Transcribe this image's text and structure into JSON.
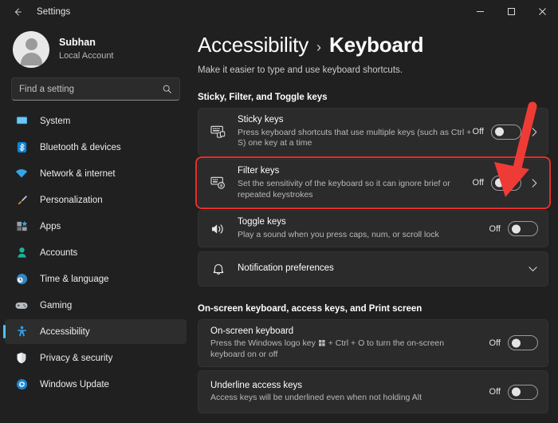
{
  "titlebar": {
    "back_label": "back-arrow",
    "title": "Settings",
    "minimize_label": "Minimize",
    "maximize_label": "Maximize",
    "close_label": "Close"
  },
  "sidebar": {
    "account": {
      "name": "Subhan",
      "type": "Local Account"
    },
    "search": {
      "placeholder": "Find a setting",
      "value": "",
      "icon": "search-icon"
    },
    "items": [
      {
        "label": "System",
        "icon": "display-icon",
        "selected": false
      },
      {
        "label": "Bluetooth & devices",
        "icon": "bluetooth-icon",
        "selected": false
      },
      {
        "label": "Network & internet",
        "icon": "wifi-icon",
        "selected": false
      },
      {
        "label": "Personalization",
        "icon": "paintbrush-icon",
        "selected": false
      },
      {
        "label": "Apps",
        "icon": "apps-icon",
        "selected": false
      },
      {
        "label": "Accounts",
        "icon": "account-icon",
        "selected": false
      },
      {
        "label": "Time & language",
        "icon": "clock-icon",
        "selected": false
      },
      {
        "label": "Gaming",
        "icon": "gamepad-icon",
        "selected": false
      },
      {
        "label": "Accessibility",
        "icon": "accessibility-icon",
        "selected": true
      },
      {
        "label": "Privacy & security",
        "icon": "shield-icon",
        "selected": false
      },
      {
        "label": "Windows Update",
        "icon": "update-icon",
        "selected": false
      }
    ]
  },
  "main": {
    "breadcrumb": {
      "parent": "Accessibility",
      "separator": "›",
      "current": "Keyboard"
    },
    "subtitle": "Make it easier to type and use keyboard shortcuts.",
    "sections": [
      {
        "heading": "Sticky, Filter, and Toggle keys",
        "rows": [
          {
            "name": "sticky-keys",
            "icon": "keyboard-sticky-icon",
            "title": "Sticky keys",
            "desc": "Press keyboard shortcuts that use multiple keys (such as Ctrl + S) one key at a time",
            "toggle_label": "Off",
            "toggle_state": "off",
            "chevron": "right",
            "highlighted": false
          },
          {
            "name": "filter-keys",
            "icon": "keyboard-filter-icon",
            "title": "Filter keys",
            "desc": "Set the sensitivity of the keyboard so it can ignore brief or repeated keystrokes",
            "toggle_label": "Off",
            "toggle_state": "off",
            "chevron": "right",
            "highlighted": true
          },
          {
            "name": "toggle-keys",
            "icon": "speaker-icon",
            "title": "Toggle keys",
            "desc": "Play a sound when you press caps, num, or scroll lock",
            "toggle_label": "Off",
            "toggle_state": "off",
            "chevron": "none",
            "highlighted": false
          },
          {
            "name": "notification-preferences",
            "icon": "bell-icon",
            "title": "Notification preferences",
            "desc": "",
            "toggle_label": "",
            "toggle_state": "none",
            "chevron": "down",
            "highlighted": false
          }
        ]
      },
      {
        "heading": "On-screen keyboard, access keys, and Print screen",
        "rows": [
          {
            "name": "on-screen-keyboard",
            "icon": "none",
            "title": "On-screen keyboard",
            "desc_pre": "Press the Windows logo key ",
            "desc_post": " + Ctrl + O to turn the on-screen keyboard on or off",
            "toggle_label": "Off",
            "toggle_state": "off",
            "chevron": "none",
            "highlighted": false
          },
          {
            "name": "underline-access-keys",
            "icon": "none",
            "title": "Underline access keys",
            "desc_pre": "Access keys will be underlined even when not holding Alt",
            "desc_post": "",
            "toggle_label": "Off",
            "toggle_state": "off",
            "chevron": "none",
            "highlighted": false
          }
        ]
      }
    ]
  },
  "annotation": {
    "arrow_color": "#ef3b36",
    "highlight_color": "#e8302a",
    "arrow_target": "filter-keys-toggle"
  },
  "colors": {
    "accent": "#4cc2ff",
    "window_bg": "#202020",
    "card_bg": "#2b2b2b"
  }
}
